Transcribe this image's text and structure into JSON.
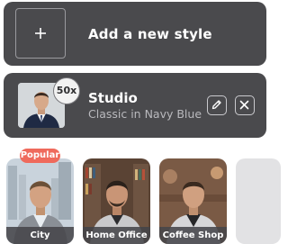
{
  "add_card": {
    "label": "Add a new style",
    "icon": "plus-icon"
  },
  "style_card": {
    "title": "Studio",
    "subtitle": "Classic in Navy Blue",
    "count_badge": "50x",
    "edit_icon": "pencil-icon",
    "delete_icon": "close-icon"
  },
  "styles": [
    {
      "label": "City",
      "badge": "Popular"
    },
    {
      "label": "Home Office"
    },
    {
      "label": "Coffee Shop"
    }
  ],
  "colors": {
    "card_bg": "#4a4a4d",
    "badge_popular": "#ef6a5c",
    "text_primary": "#ffffff",
    "text_secondary": "#b9b9bd"
  }
}
